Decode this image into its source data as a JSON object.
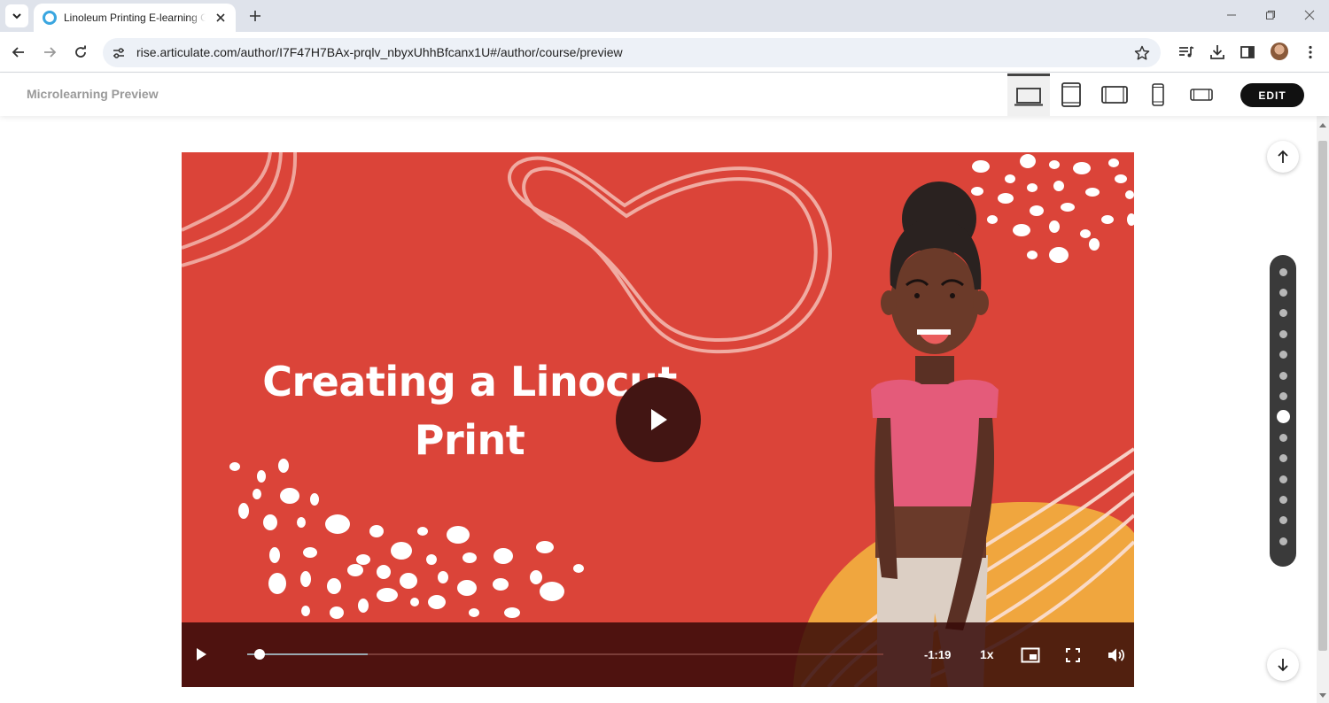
{
  "browser": {
    "tab_title": "Linoleum Printing E-learning Guide",
    "url": "rise.articulate.com/author/I7F47H7BAx-prqlv_nbyxUhhBfcanx1U#/author/course/preview"
  },
  "preview_header": {
    "title": "Microlearning Preview",
    "devices": [
      "desktop",
      "tablet-portrait",
      "tablet-landscape",
      "phone-portrait",
      "phone-landscape"
    ],
    "active_device": "desktop",
    "edit_label": "EDIT"
  },
  "video": {
    "title_line1": "Creating a Linocut",
    "title_line2": "Print",
    "time_remaining": "-1:19",
    "speed": "1x",
    "progress": 0.02,
    "buffered": 0.19
  },
  "lesson_nav": {
    "dot_count": 14,
    "current_index": 7
  },
  "colors": {
    "video_background": "#db4439",
    "accent_orange": "#f0a63e",
    "shirt_pink": "#e45b7a"
  }
}
